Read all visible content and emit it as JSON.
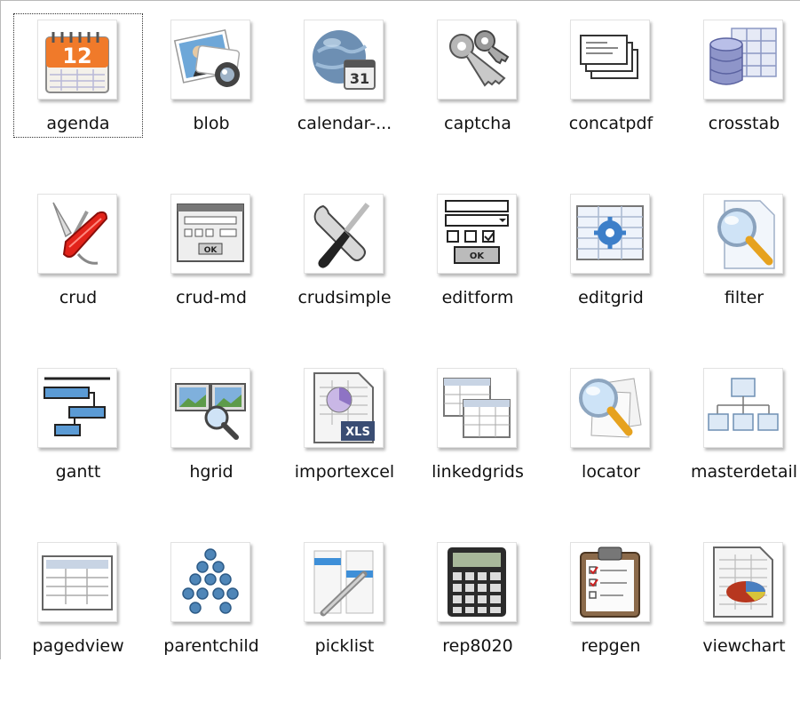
{
  "items": [
    {
      "label": "agenda",
      "icon": "calendar-page-icon",
      "text": "12"
    },
    {
      "label": "blob",
      "icon": "photo-camera-icon"
    },
    {
      "label": "calendar-...",
      "icon": "globe-calendar-icon",
      "text": "31"
    },
    {
      "label": "captcha",
      "icon": "keys-icon"
    },
    {
      "label": "concatpdf",
      "icon": "stacked-pages-icon"
    },
    {
      "label": "crosstab",
      "icon": "database-table-icon"
    },
    {
      "label": "crud",
      "icon": "swiss-knife-icon"
    },
    {
      "label": "crud-md",
      "icon": "form-window-icon",
      "text": "OK"
    },
    {
      "label": "crudsimple",
      "icon": "wrench-screwdriver-icon"
    },
    {
      "label": "editform",
      "icon": "edit-form-icon",
      "text": "OK"
    },
    {
      "label": "editgrid",
      "icon": "grid-gear-icon"
    },
    {
      "label": "filter",
      "icon": "magnifier-document-icon"
    },
    {
      "label": "gantt",
      "icon": "gantt-bars-icon"
    },
    {
      "label": "hgrid",
      "icon": "image-grid-magnifier-icon"
    },
    {
      "label": "importexcel",
      "icon": "excel-file-icon",
      "text": "XLS"
    },
    {
      "label": "linkedgrids",
      "icon": "linked-grids-icon"
    },
    {
      "label": "locator",
      "icon": "magnifier-papers-icon"
    },
    {
      "label": "masterdetail",
      "icon": "tree-grid-icon"
    },
    {
      "label": "pagedview",
      "icon": "paged-grid-icon"
    },
    {
      "label": "parentchild",
      "icon": "node-tree-icon"
    },
    {
      "label": "picklist",
      "icon": "pen-list-icon"
    },
    {
      "label": "rep8020",
      "icon": "calculator-icon"
    },
    {
      "label": "repgen",
      "icon": "clipboard-checklist-icon"
    },
    {
      "label": "viewchart",
      "icon": "pie-chart-sheet-icon"
    }
  ],
  "focused_index": 0,
  "colors": {
    "label": "#111111",
    "focus_outline": "#333333",
    "background": "#ffffff"
  }
}
